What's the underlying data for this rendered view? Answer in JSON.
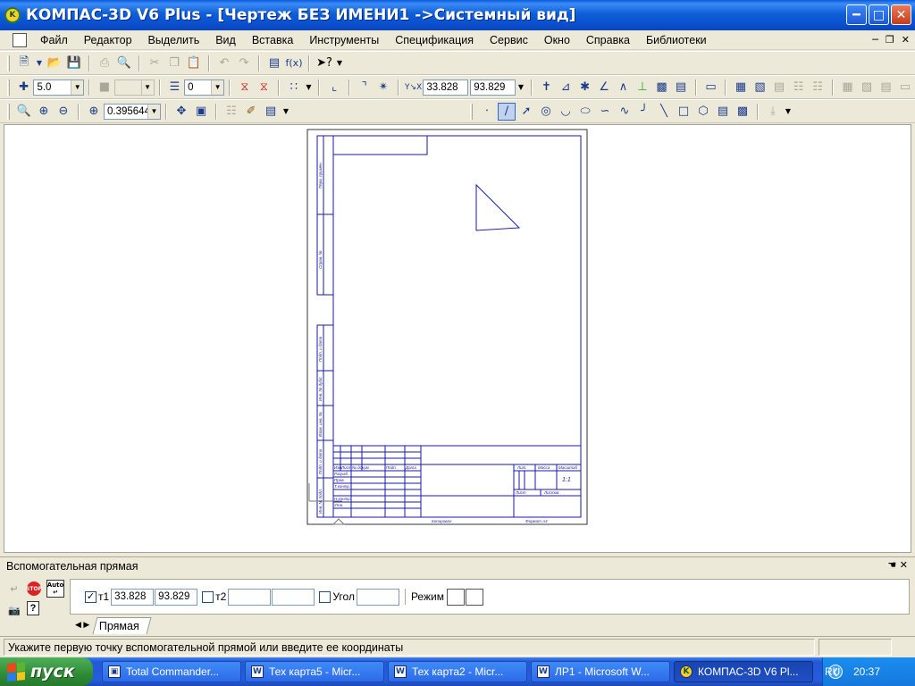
{
  "window": {
    "title": "КОМПАС-3D V6 Plus - [Чертеж БЕЗ ИМЕНИ1 ->Системный вид]",
    "icon": "kompas-icon"
  },
  "menu": {
    "items": [
      "Файл",
      "Редактор",
      "Выделить",
      "Вид",
      "Вставка",
      "Инструменты",
      "Спецификация",
      "Сервис",
      "Окно",
      "Справка",
      "Библиотеки"
    ]
  },
  "toolbar2": {
    "step_value": "5.0",
    "layer_value": "0",
    "x_coord": "33.828",
    "y_coord": "93.829"
  },
  "toolbar3": {
    "zoom_value": "0.395644"
  },
  "drawing": {
    "sheet_label": "1:1",
    "title_block_labels": [
      "Изм.",
      "Лист",
      "№ докум.",
      "Подп.",
      "Дата",
      "Разраб.",
      "Пров.",
      "Т.контр.",
      "Н.контр.",
      "Утв.",
      "Лит.",
      "Масса",
      "Масштаб",
      "Лист",
      "Листов",
      "Копировал",
      "Формат А4"
    ],
    "side_labels": [
      "Перв. примен.",
      "Справ. №",
      "Подп. и дата",
      "Инв. № дубл.",
      "Взам. инв. №",
      "Подп. и дата",
      "Инв. № подл."
    ]
  },
  "panel": {
    "title": "Вспомогательная прямая",
    "t1_label": "т1",
    "t1_x": "33.828",
    "t1_y": "93.829",
    "t2_label": "т2",
    "t2_x": "",
    "t2_y": "",
    "angle_label": "Угол",
    "angle_value": "",
    "mode_label": "Режим",
    "tab_label": "Прямая",
    "stop_label": "STOP",
    "auto_label": "Auto"
  },
  "status": {
    "text": "Укажите первую точку вспомогательной прямой или введите ее координаты"
  },
  "taskbar": {
    "start_label": "пуск",
    "tasks": [
      {
        "label": "Total Commander...",
        "icon": "floppy-icon"
      },
      {
        "label": "Тех карта5 - Micr...",
        "icon": "word-icon"
      },
      {
        "label": "Тех карта2 - Micr...",
        "icon": "word-icon"
      },
      {
        "label": "ЛР1 - Microsoft W...",
        "icon": "word-icon"
      },
      {
        "label": "КОМПАС-3D V6 Pl...",
        "icon": "kompas-icon"
      }
    ],
    "language": "RU",
    "clock": "20:37"
  },
  "colors": {
    "titlebar": "#0a4fcf",
    "sheet_lines": "#1a1aa8",
    "taskbar": "#245ddb",
    "start": "#2f8a35"
  }
}
